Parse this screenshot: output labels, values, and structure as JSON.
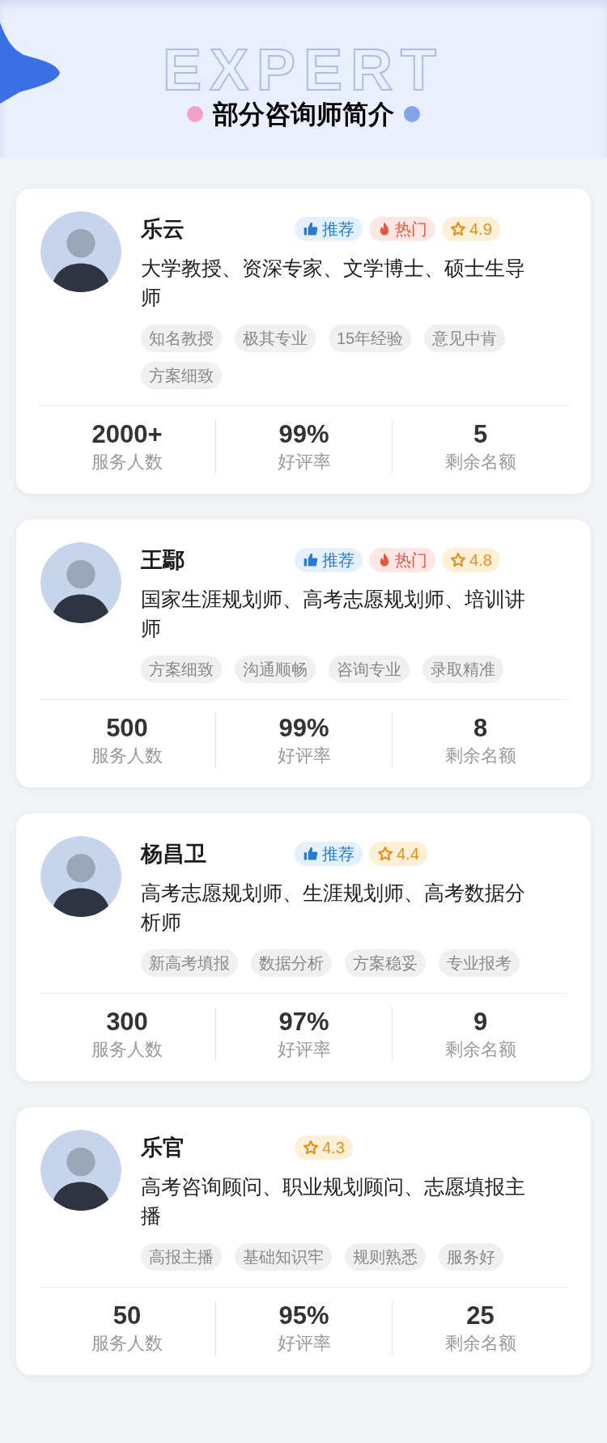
{
  "header": {
    "background_word": "EXPERT",
    "title": "部分咨询师简介"
  },
  "counselors": [
    {
      "name": "乐云",
      "badges": [
        {
          "kind": "recommend",
          "label": "推荐"
        },
        {
          "kind": "hot",
          "label": "热门"
        },
        {
          "kind": "rating",
          "label": "4.9"
        }
      ],
      "title": "大学教授、资深专家、文学博士、硕士生导师",
      "tags": [
        "知名教授",
        "极其专业",
        "15年经验",
        "意见中肯",
        "方案细致"
      ],
      "stats": [
        {
          "value": "2000+",
          "label": "服务人数"
        },
        {
          "value": "99%",
          "label": "好评率"
        },
        {
          "value": "5",
          "label": "剩余名额"
        }
      ]
    },
    {
      "name": "王鄢",
      "badges": [
        {
          "kind": "recommend",
          "label": "推荐"
        },
        {
          "kind": "hot",
          "label": "热门"
        },
        {
          "kind": "rating",
          "label": "4.8"
        }
      ],
      "title": "国家生涯规划师、高考志愿规划师、培训讲师",
      "tags": [
        "方案细致",
        "沟通顺畅",
        "咨询专业",
        "录取精准"
      ],
      "stats": [
        {
          "value": "500",
          "label": "服务人数"
        },
        {
          "value": "99%",
          "label": "好评率"
        },
        {
          "value": "8",
          "label": "剩余名额"
        }
      ]
    },
    {
      "name": "杨昌卫",
      "badges": [
        {
          "kind": "recommend",
          "label": "推荐"
        },
        {
          "kind": "rating",
          "label": "4.4"
        }
      ],
      "title": "高考志愿规划师、生涯规划师、高考数据分析师",
      "tags": [
        "新高考填报",
        "数据分析",
        "方案稳妥",
        "专业报考"
      ],
      "stats": [
        {
          "value": "300",
          "label": "服务人数"
        },
        {
          "value": "97%",
          "label": "好评率"
        },
        {
          "value": "9",
          "label": "剩余名额"
        }
      ]
    },
    {
      "name": "乐官",
      "badges": [
        {
          "kind": "rating",
          "label": "4.3"
        }
      ],
      "title": "高考咨询顾问、职业规划顾问、志愿填报主播",
      "tags": [
        "高报主播",
        "基础知识牢",
        "规则熟悉",
        "服务好"
      ],
      "stats": [
        {
          "value": "50",
          "label": "服务人数"
        },
        {
          "value": "95%",
          "label": "好评率"
        },
        {
          "value": "25",
          "label": "剩余名额"
        }
      ]
    }
  ]
}
